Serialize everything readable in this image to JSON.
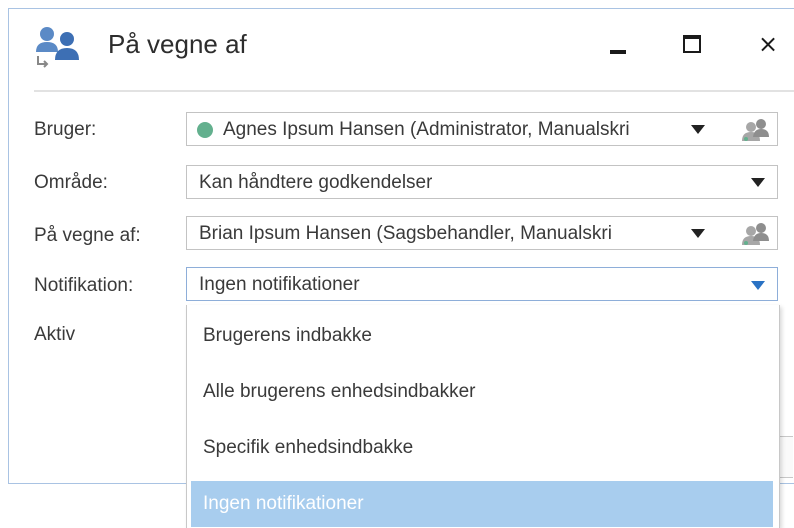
{
  "window": {
    "title": "På vegne af",
    "icon": "users-delegate-icon",
    "controls": {
      "minimize": "minimize-icon",
      "maximize": "maximize-icon",
      "close": "×"
    }
  },
  "form": {
    "user": {
      "label": "Bruger:",
      "value": "Agnes Ipsum Hansen (Administrator, Manualskri",
      "status_color": "#63b08e"
    },
    "area": {
      "label": "Område:",
      "value": "Kan håndtere godkendelser"
    },
    "on_behalf_of": {
      "label": "På vegne af:",
      "value": "Brian Ipsum Hansen (Sagsbehandler, Manualskri"
    },
    "notification": {
      "label": "Notifikation:",
      "value": "Ingen notifikationer",
      "accent": "#2a72c4"
    },
    "active": {
      "label": "Aktiv"
    }
  },
  "dropdown": {
    "options": [
      "Brugerens indbakke",
      "Alle brugerens enhedsindbakker",
      "Specifik enhedsindbakke",
      "Ingen notifikationer"
    ],
    "selected_index": 3,
    "highlight_color": "#a8cdee"
  }
}
